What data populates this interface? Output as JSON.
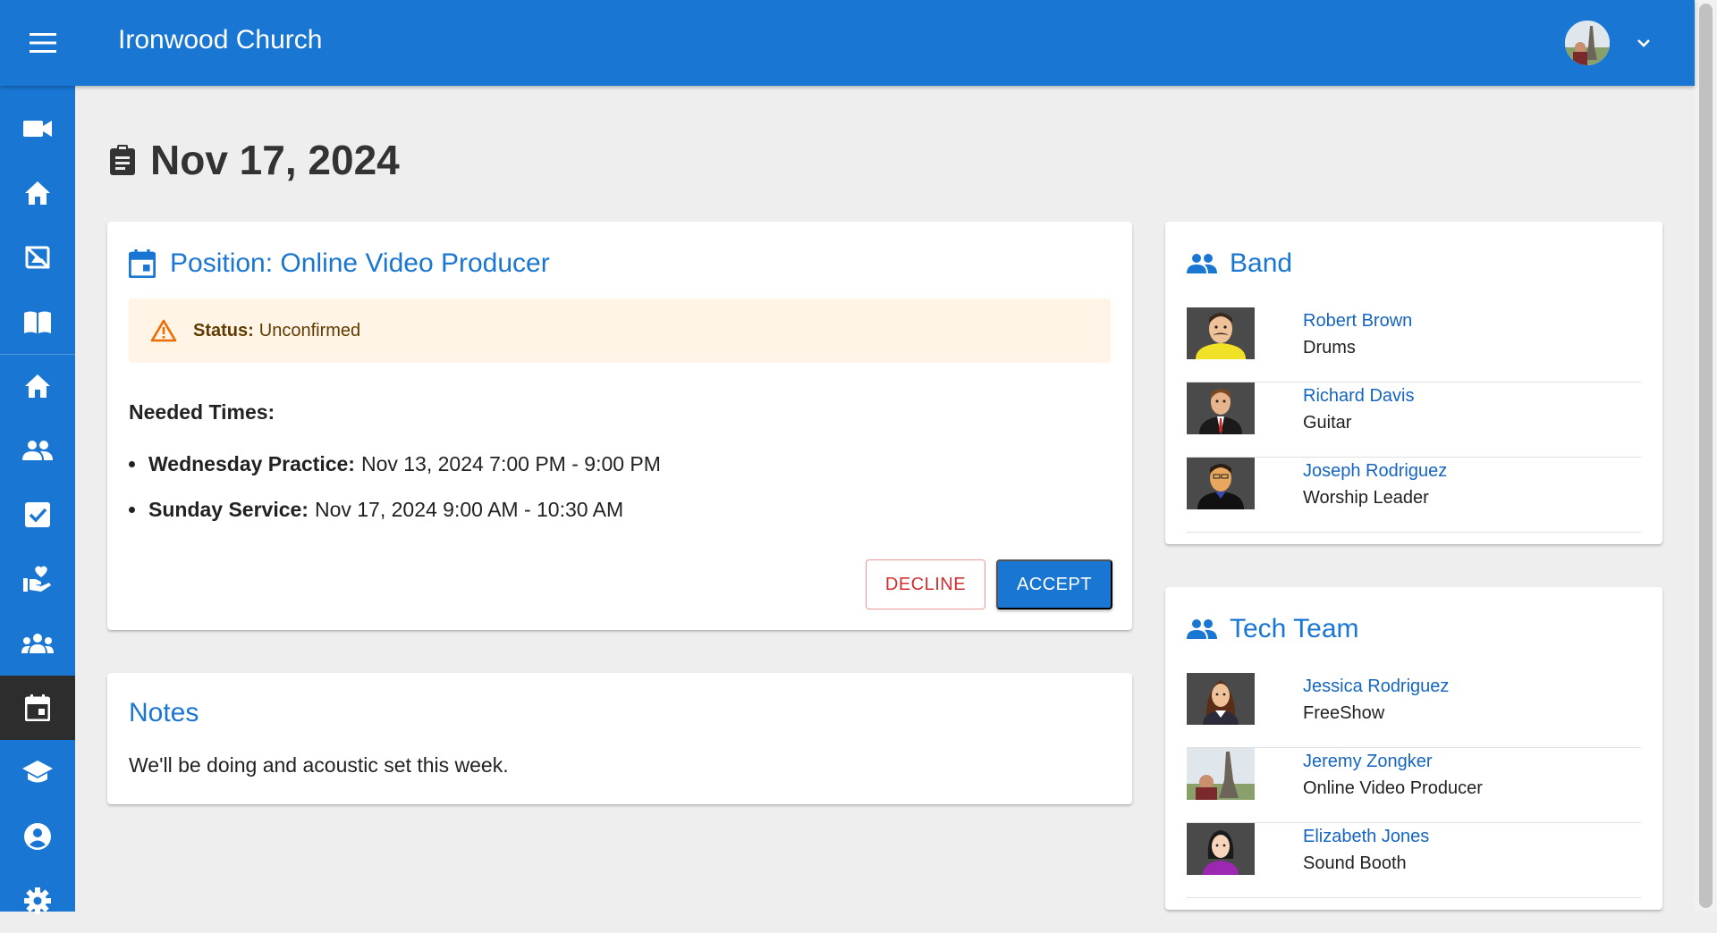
{
  "app": {
    "title": "Ironwood Church"
  },
  "sidebar": {
    "items": [
      {
        "icon": "video-camera-icon",
        "label": "Stream"
      },
      {
        "icon": "home-icon",
        "label": "Home"
      },
      {
        "icon": "no-photography-icon",
        "label": "Media"
      },
      {
        "icon": "book-icon",
        "label": "Bible"
      },
      {
        "icon": "home-icon",
        "label": "Dashboard"
      },
      {
        "icon": "people-icon",
        "label": "People"
      },
      {
        "icon": "checkbox-icon",
        "label": "Tasks"
      },
      {
        "icon": "volunteer-icon",
        "label": "Serving"
      },
      {
        "icon": "groups-icon",
        "label": "Groups"
      },
      {
        "icon": "calendar-icon",
        "label": "Plans"
      },
      {
        "icon": "school-icon",
        "label": "Lessons"
      },
      {
        "icon": "account-circle-icon",
        "label": "Profile"
      },
      {
        "icon": "gear-icon",
        "label": "Settings"
      }
    ],
    "active_index": 9
  },
  "page": {
    "date_title": "Nov 17, 2024"
  },
  "position_card": {
    "title": "Position: Online Video Producer",
    "status_label": "Status:",
    "status_value": "Unconfirmed",
    "needed_times_label": "Needed Times:",
    "times": [
      {
        "label": "Wednesday Practice:",
        "value": "Nov 13, 2024 7:00 PM - 9:00 PM"
      },
      {
        "label": "Sunday Service:",
        "value": "Nov 17, 2024 9:00 AM - 10:30 AM"
      }
    ],
    "decline_label": "DECLINE",
    "accept_label": "ACCEPT"
  },
  "notes_card": {
    "title": "Notes",
    "text": "We'll be doing and acoustic set this week."
  },
  "teams": [
    {
      "title": "Band",
      "members": [
        {
          "name": "Robert Brown",
          "role": "Drums"
        },
        {
          "name": "Richard Davis",
          "role": "Guitar"
        },
        {
          "name": "Joseph Rodriguez",
          "role": "Worship Leader"
        }
      ]
    },
    {
      "title": "Tech Team",
      "members": [
        {
          "name": "Jessica Rodriguez",
          "role": "FreeShow"
        },
        {
          "name": "Jeremy Zongker",
          "role": "Online Video Producer"
        },
        {
          "name": "Elizabeth Jones",
          "role": "Sound Booth"
        }
      ]
    }
  ],
  "colors": {
    "primary": "#1976d2",
    "background": "#eeeeee",
    "warning_bg": "#fff4e5",
    "warning_icon": "#ed6c02",
    "error": "#d32f2f"
  }
}
